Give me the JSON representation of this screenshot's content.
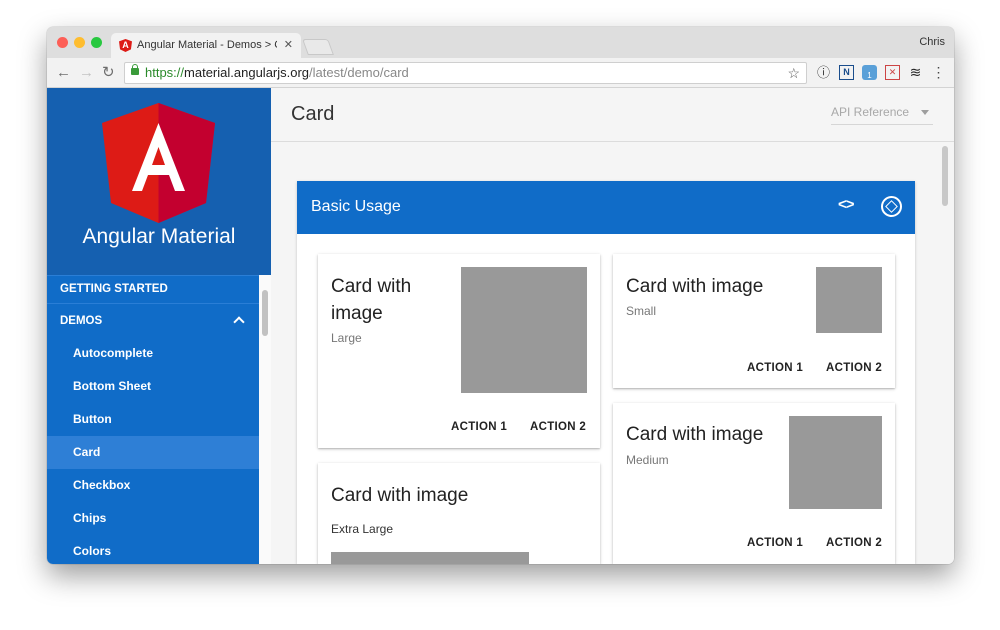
{
  "browser": {
    "tab_title": "Angular Material - Demos > Ca",
    "favicon_glyph": "A",
    "close_glyph": "✕",
    "profile_name": "Chris",
    "url_scheme": "https://",
    "url_host": "material.angularjs.org",
    "url_path": "/latest/demo/card",
    "back_glyph": "←",
    "forward_glyph": "→",
    "reload_glyph": "↻",
    "star_glyph": "☆",
    "extensions": [
      {
        "name": "info-icon",
        "glyph": "ⓘ"
      },
      {
        "name": "n-extension-icon",
        "glyph": "N"
      },
      {
        "name": "badge-extension-icon",
        "glyph": "1"
      },
      {
        "name": "x-extension-icon",
        "glyph": "✕"
      },
      {
        "name": "layers-icon",
        "glyph": "≋"
      },
      {
        "name": "menu-dots-icon",
        "glyph": "⋮"
      }
    ]
  },
  "sidebar": {
    "brand_name": "Angular Material",
    "logo_letter": "A",
    "getting_started": "GETTING STARTED",
    "demos": "DEMOS",
    "items": [
      "Autocomplete",
      "Bottom Sheet",
      "Button",
      "Card",
      "Checkbox",
      "Chips",
      "Colors"
    ],
    "active_item": "Card"
  },
  "header": {
    "title": "Card",
    "api_select": "API Reference"
  },
  "demo": {
    "title": "Basic Usage",
    "code_glyph": "<>",
    "cards": [
      {
        "headline": "Card with image",
        "subhead": "Large",
        "action1": "ACTION 1",
        "action2": "ACTION 2"
      },
      {
        "headline": "Card with image",
        "subhead": "Small",
        "action1": "ACTION 1",
        "action2": "ACTION 2"
      },
      {
        "headline": "Card with image",
        "subhead": "Medium",
        "action1": "ACTION 1",
        "action2": "ACTION 2"
      },
      {
        "headline": "Card with image",
        "subhead": "Extra Large"
      }
    ]
  },
  "colors": {
    "primary": "#106cc8",
    "angular_red": "#dd1b16",
    "placeholder_gray": "#999999"
  }
}
